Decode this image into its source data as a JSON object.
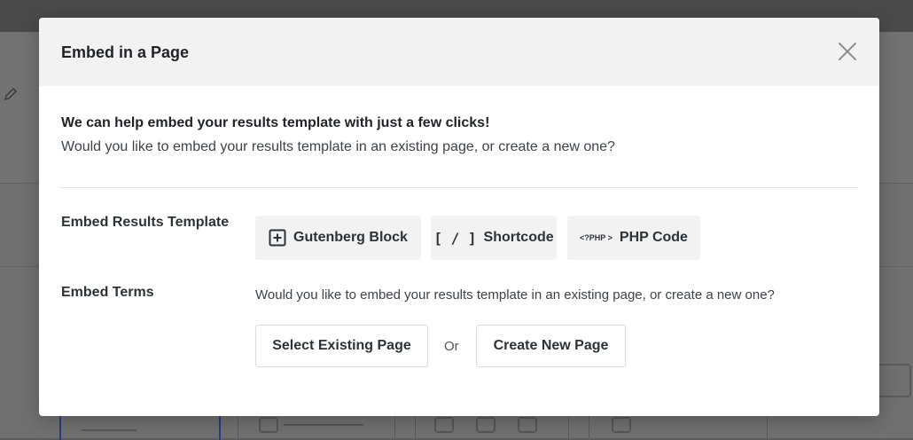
{
  "modal": {
    "title": "Embed in a Page",
    "close_icon": "close-icon"
  },
  "intro": {
    "title": "We can help embed your results template with just a few clicks!",
    "text": "Would you like to embed your results template in an existing page, or create a new one?"
  },
  "embed_template": {
    "label": "Embed Results Template",
    "options": [
      {
        "label": "Gutenberg Block",
        "icon": "plus-square-icon"
      },
      {
        "label": "Shortcode",
        "icon": "[ / ]"
      },
      {
        "label": "PHP Code",
        "icon": "<?PHP >"
      }
    ]
  },
  "embed_terms": {
    "label": "Embed Terms",
    "text": "Would you like to embed your results template in an existing page, or create a new one?",
    "select_existing_label": "Select Existing Page",
    "or_label": "Or",
    "create_new_label": "Create New Page"
  }
}
